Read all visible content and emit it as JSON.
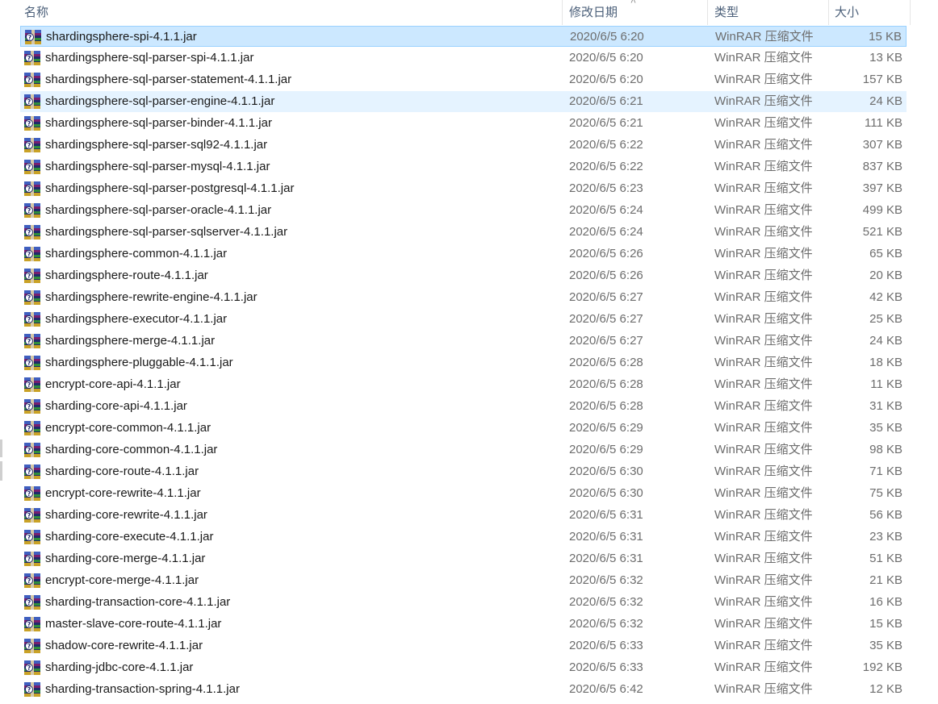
{
  "columns": {
    "name": "名称",
    "date": "修改日期",
    "type": "类型",
    "size": "大小"
  },
  "sort_icon": "chevron-up-icon",
  "file_icon": "winrar-archive-icon",
  "rows": [
    {
      "name": "shardingsphere-spi-4.1.1.jar",
      "date": "2020/6/5 6:20",
      "type": "WinRAR 压缩文件",
      "size": "15 KB",
      "state": "selected"
    },
    {
      "name": "shardingsphere-sql-parser-spi-4.1.1.jar",
      "date": "2020/6/5 6:20",
      "type": "WinRAR 压缩文件",
      "size": "13 KB",
      "state": ""
    },
    {
      "name": "shardingsphere-sql-parser-statement-4.1.1.jar",
      "date": "2020/6/5 6:20",
      "type": "WinRAR 压缩文件",
      "size": "157 KB",
      "state": ""
    },
    {
      "name": "shardingsphere-sql-parser-engine-4.1.1.jar",
      "date": "2020/6/5 6:21",
      "type": "WinRAR 压缩文件",
      "size": "24 KB",
      "state": "hover"
    },
    {
      "name": "shardingsphere-sql-parser-binder-4.1.1.jar",
      "date": "2020/6/5 6:21",
      "type": "WinRAR 压缩文件",
      "size": "111 KB",
      "state": ""
    },
    {
      "name": "shardingsphere-sql-parser-sql92-4.1.1.jar",
      "date": "2020/6/5 6:22",
      "type": "WinRAR 压缩文件",
      "size": "307 KB",
      "state": ""
    },
    {
      "name": "shardingsphere-sql-parser-mysql-4.1.1.jar",
      "date": "2020/6/5 6:22",
      "type": "WinRAR 压缩文件",
      "size": "837 KB",
      "state": ""
    },
    {
      "name": "shardingsphere-sql-parser-postgresql-4.1.1.jar",
      "date": "2020/6/5 6:23",
      "type": "WinRAR 压缩文件",
      "size": "397 KB",
      "state": ""
    },
    {
      "name": "shardingsphere-sql-parser-oracle-4.1.1.jar",
      "date": "2020/6/5 6:24",
      "type": "WinRAR 压缩文件",
      "size": "499 KB",
      "state": ""
    },
    {
      "name": "shardingsphere-sql-parser-sqlserver-4.1.1.jar",
      "date": "2020/6/5 6:24",
      "type": "WinRAR 压缩文件",
      "size": "521 KB",
      "state": ""
    },
    {
      "name": "shardingsphere-common-4.1.1.jar",
      "date": "2020/6/5 6:26",
      "type": "WinRAR 压缩文件",
      "size": "65 KB",
      "state": ""
    },
    {
      "name": "shardingsphere-route-4.1.1.jar",
      "date": "2020/6/5 6:26",
      "type": "WinRAR 压缩文件",
      "size": "20 KB",
      "state": ""
    },
    {
      "name": "shardingsphere-rewrite-engine-4.1.1.jar",
      "date": "2020/6/5 6:27",
      "type": "WinRAR 压缩文件",
      "size": "42 KB",
      "state": ""
    },
    {
      "name": "shardingsphere-executor-4.1.1.jar",
      "date": "2020/6/5 6:27",
      "type": "WinRAR 压缩文件",
      "size": "25 KB",
      "state": ""
    },
    {
      "name": "shardingsphere-merge-4.1.1.jar",
      "date": "2020/6/5 6:27",
      "type": "WinRAR 压缩文件",
      "size": "24 KB",
      "state": ""
    },
    {
      "name": "shardingsphere-pluggable-4.1.1.jar",
      "date": "2020/6/5 6:28",
      "type": "WinRAR 压缩文件",
      "size": "18 KB",
      "state": ""
    },
    {
      "name": "encrypt-core-api-4.1.1.jar",
      "date": "2020/6/5 6:28",
      "type": "WinRAR 压缩文件",
      "size": "11 KB",
      "state": ""
    },
    {
      "name": "sharding-core-api-4.1.1.jar",
      "date": "2020/6/5 6:28",
      "type": "WinRAR 压缩文件",
      "size": "31 KB",
      "state": ""
    },
    {
      "name": "encrypt-core-common-4.1.1.jar",
      "date": "2020/6/5 6:29",
      "type": "WinRAR 压缩文件",
      "size": "35 KB",
      "state": ""
    },
    {
      "name": "sharding-core-common-4.1.1.jar",
      "date": "2020/6/5 6:29",
      "type": "WinRAR 压缩文件",
      "size": "98 KB",
      "state": ""
    },
    {
      "name": "sharding-core-route-4.1.1.jar",
      "date": "2020/6/5 6:30",
      "type": "WinRAR 压缩文件",
      "size": "71 KB",
      "state": ""
    },
    {
      "name": "encrypt-core-rewrite-4.1.1.jar",
      "date": "2020/6/5 6:30",
      "type": "WinRAR 压缩文件",
      "size": "75 KB",
      "state": ""
    },
    {
      "name": "sharding-core-rewrite-4.1.1.jar",
      "date": "2020/6/5 6:31",
      "type": "WinRAR 压缩文件",
      "size": "56 KB",
      "state": ""
    },
    {
      "name": "sharding-core-execute-4.1.1.jar",
      "date": "2020/6/5 6:31",
      "type": "WinRAR 压缩文件",
      "size": "23 KB",
      "state": ""
    },
    {
      "name": "sharding-core-merge-4.1.1.jar",
      "date": "2020/6/5 6:31",
      "type": "WinRAR 压缩文件",
      "size": "51 KB",
      "state": ""
    },
    {
      "name": "encrypt-core-merge-4.1.1.jar",
      "date": "2020/6/5 6:32",
      "type": "WinRAR 压缩文件",
      "size": "21 KB",
      "state": ""
    },
    {
      "name": "sharding-transaction-core-4.1.1.jar",
      "date": "2020/6/5 6:32",
      "type": "WinRAR 压缩文件",
      "size": "16 KB",
      "state": ""
    },
    {
      "name": "master-slave-core-route-4.1.1.jar",
      "date": "2020/6/5 6:32",
      "type": "WinRAR 压缩文件",
      "size": "15 KB",
      "state": ""
    },
    {
      "name": "shadow-core-rewrite-4.1.1.jar",
      "date": "2020/6/5 6:33",
      "type": "WinRAR 压缩文件",
      "size": "35 KB",
      "state": ""
    },
    {
      "name": "sharding-jdbc-core-4.1.1.jar",
      "date": "2020/6/5 6:33",
      "type": "WinRAR 压缩文件",
      "size": "192 KB",
      "state": ""
    },
    {
      "name": "sharding-transaction-spring-4.1.1.jar",
      "date": "2020/6/5 6:42",
      "type": "WinRAR 压缩文件",
      "size": "12 KB",
      "state": ""
    }
  ]
}
